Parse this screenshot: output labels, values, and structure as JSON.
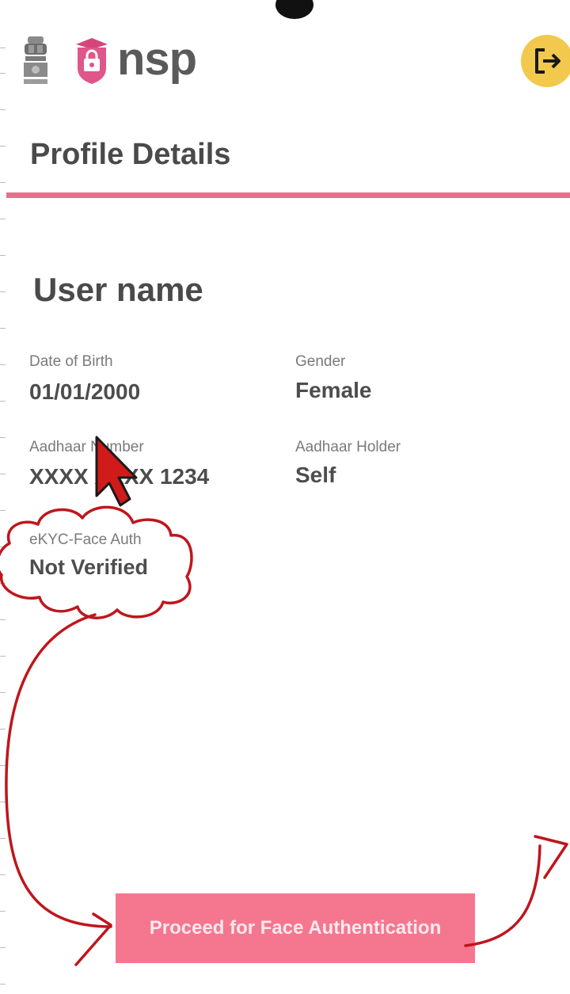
{
  "header": {
    "emblem_icon": "national-emblem-icon",
    "logo_icon": "nsp-shield-logo-icon",
    "app_name": "nsp",
    "logout_icon": "logout-icon",
    "logout_color": "#f2c94c"
  },
  "page": {
    "title": "Profile Details",
    "accent_color": "#e7708d"
  },
  "profile": {
    "user_name": "User name",
    "fields": [
      {
        "label": "Date of Birth",
        "value": "01/01/2000"
      },
      {
        "label": "Gender",
        "value": "Female"
      },
      {
        "label": "Aadhaar Number",
        "value": "XXXX XXXX 1234"
      },
      {
        "label": "Aadhaar Holder",
        "value": "Self"
      },
      {
        "label": "eKYC-Face Auth",
        "value": "Not Verified"
      }
    ]
  },
  "actions": {
    "proceed_label": "Proceed for Face Authentication",
    "proceed_color": "#f4778f"
  },
  "annotations": {
    "color": "#c0151c",
    "cursor_icon": "mouse-pointer-icon"
  }
}
